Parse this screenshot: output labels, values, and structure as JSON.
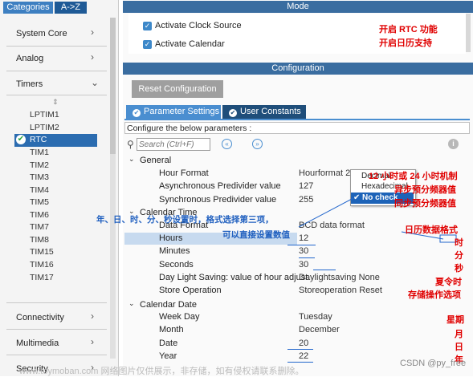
{
  "sidebar": {
    "tab_categories": "Categories",
    "tab_az": "A->Z",
    "categories": [
      "System Core",
      "Analog",
      "Timers",
      "Connectivity",
      "Multimedia",
      "Security"
    ],
    "timers": [
      "LPTIM1",
      "LPTIM2",
      "RTC",
      "TIM1",
      "TIM2",
      "TIM3",
      "TIM4",
      "TIM5",
      "TIM6",
      "TIM7",
      "TIM8",
      "TIM15",
      "TIM16",
      "TIM17"
    ]
  },
  "mode": {
    "title": "Mode",
    "activate_clock": "Activate Clock Source",
    "activate_calendar": "Activate Calendar"
  },
  "configuration": {
    "title": "Configuration",
    "reset_button": "Reset Configuration",
    "tab_params": "Parameter Settings",
    "tab_constants": "User Constants",
    "configure_text": "Configure the below parameters :",
    "search_placeholder": "Search (Ctrl+F)",
    "general": {
      "label": "General",
      "hour_format": "Hour Format",
      "hour_format_val": "Hourformat 24",
      "async": "Asynchronous Predivider value",
      "async_val": "127",
      "sync": "Synchronous Predivider value",
      "sync_val": "255"
    },
    "calendar_time": {
      "label": "Calendar Time",
      "data_format": "Data Format",
      "data_format_val": "BCD data format",
      "hours": "Hours",
      "hours_val": "12",
      "minutes": "Minutes",
      "minutes_val": "30",
      "seconds": "Seconds",
      "seconds_val": "30",
      "dst": "Day Light Saving: value of hour adjust.",
      "dst_val": "Daylightsaving None",
      "store": "Store Operation",
      "store_val": "Storeoperation Reset"
    },
    "calendar_date": {
      "label": "Calendar Date",
      "weekday": "Week Day",
      "weekday_val": "Tuesday",
      "month": "Month",
      "month_val": "December",
      "date": "Date",
      "date_val": "20",
      "year": "Year",
      "year_val": "22"
    },
    "dropdown": [
      "Decimal",
      "Hexadecimal",
      "No check"
    ]
  },
  "annotations": {
    "rtc_func": "开启 RTC 功能",
    "calendar_support": "开启日历支持",
    "hour_mode": "12 小时或 24 小时机制",
    "async_div": "异步预分频器值",
    "sync_div": "同步预分频器值",
    "ymd_note": "年、日、时、分、秒设置时，格式选择第三项，",
    "direct_set": "可以直接设置数值",
    "calendar_format": "日历数据格式",
    "hour": "时",
    "minute": "分",
    "second": "秒",
    "summer": "夏令时",
    "store_opt": "存储操作选项",
    "week": "星期",
    "month": "月",
    "day": "日",
    "year": "年"
  },
  "watermark": {
    "left": "www.toymoban.com 网络图片仅供展示，非存储，如有侵权请联系删除。",
    "right": "CSDN @py_free"
  },
  "colors": {
    "header_bar": "#3a6da0",
    "tab_active": "#4a8ed0",
    "tab_dark": "#1f4e7a",
    "annotation_red": "#e00000",
    "annotation_blue": "#1f5fbf",
    "selection": "#2b6cb0"
  }
}
